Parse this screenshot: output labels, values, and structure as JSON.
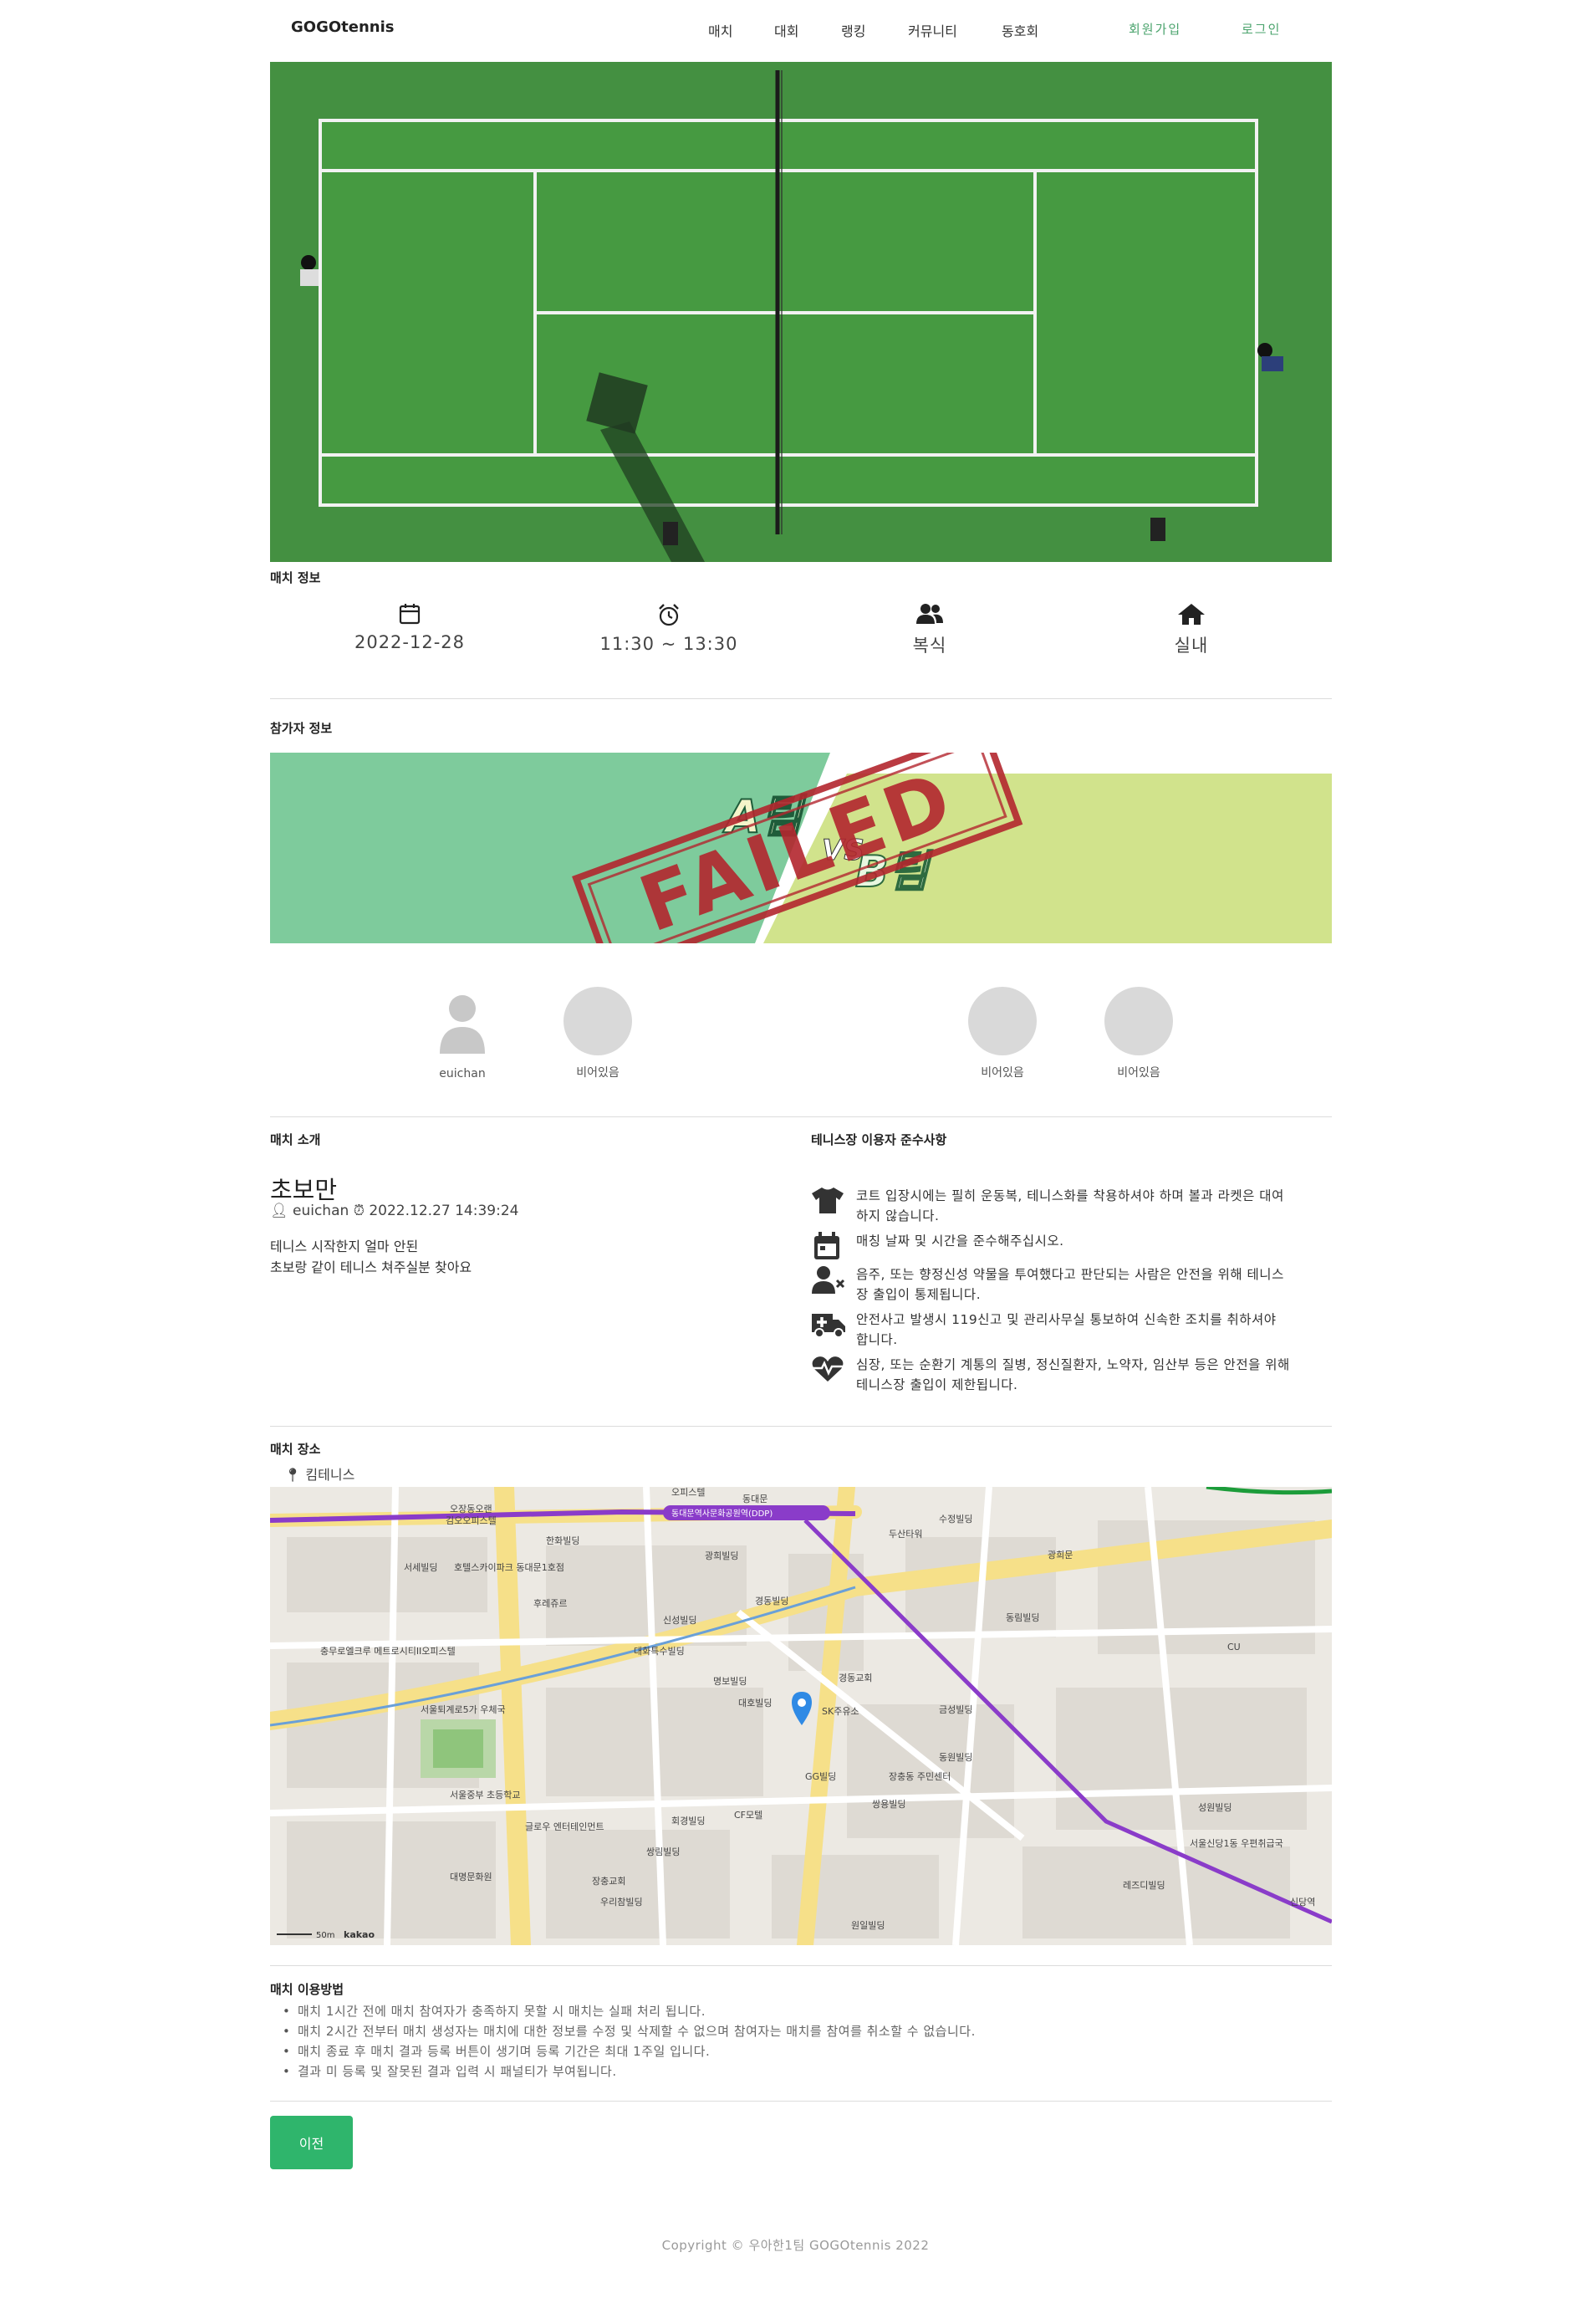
{
  "nav": {
    "brand": "GOGOtennis",
    "menu": [
      "매치",
      "대회",
      "랭킹",
      "커뮤니티",
      "동호회"
    ],
    "signup": "회원가입",
    "login": "로그인"
  },
  "match_info": {
    "title": "매치 정보",
    "date": "2022-12-28",
    "time": "11:30 ~ 13:30",
    "type": "복식",
    "venue_type": "실내"
  },
  "participants": {
    "title": "참가자 정보",
    "banner_team_a": "A팀",
    "banner_vs": "VS",
    "banner_team_b": "B팀",
    "stamp": "FAILED",
    "players": [
      {
        "name": "euichan"
      },
      {
        "name": "비어있음"
      },
      {
        "name": "비어있음"
      },
      {
        "name": "비어있음"
      }
    ]
  },
  "intro": {
    "title": "매치 소개",
    "heading": "초보만",
    "author": "euichan",
    "datetime": "2022.12.27 14:39:24",
    "line1": "테니스 시작한지 얼마 안된",
    "line2": "초보랑 같이 테니스 쳐주실분 찾아요"
  },
  "rules": {
    "title": "테니스장 이용자 준수사항",
    "items": [
      {
        "icon": "shirt-icon",
        "text": "코트 입장시에는 필히 운동복, 테니스화를 착용하셔야 하며 볼과 라켓은 대여하지 않습니다."
      },
      {
        "icon": "calendar-icon",
        "text": "매칭 날짜 및 시간을 준수해주십시오."
      },
      {
        "icon": "user-x-icon",
        "text": "음주, 또는 향정신성 약물을 투여했다고 판단되는 사람은 안전을 위해 테니스장 출입이 통제됩니다."
      },
      {
        "icon": "ambulance-icon",
        "text": "안전사고 발생시 119신고 및 관리사무실 통보하여 신속한 조치를 취하셔야 합니다."
      },
      {
        "icon": "heart-pulse-icon",
        "text": "심장, 또는 순환기 계통의 질병, 정신질환자, 노약자, 임산부 등은 안전을 위해 테니스장 출입이 제한됩니다."
      }
    ]
  },
  "place": {
    "title": "매치 장소",
    "name": "킴테니스",
    "map_scale": "50m",
    "map_brand": "kakao",
    "map_labels": [
      "오장동오랜",
      "김오오피스텔",
      "동대문",
      "한화빌딩",
      "서세빌딩",
      "호텔스카이파크 동대문1호점",
      "후레쥬르",
      "신성빌딩",
      "대화특수빌딩",
      "명보빌딩",
      "대호빌딩",
      "SK주유소",
      "경동교회",
      "금성빌딩",
      "쌍용빌딩",
      "충무로엘크루 메트로시티II오피스텔",
      "서울퇴계로5가 우체국",
      "서울중부 초등학교",
      "대명문화원",
      "글로우 엔터테인먼트",
      "회경빌딩",
      "CF모텔",
      "성원빌딩",
      "쌍림빌딩",
      "우리참빌딩",
      "장충교회",
      "원일빌딩",
      "GG빌딩",
      "장충동 주민센터",
      "동림빌딩",
      "동원빌딩",
      "광희빌딩",
      "레즈디빌딩",
      "수정빌딩",
      "오피스텔",
      "서울신당1동 우편취급국",
      "경동빌딩",
      "두산타워",
      "광희문",
      "신당역",
      "CU",
      "동대문역사문화공원역(DDP)"
    ]
  },
  "usage": {
    "title": "매치 이용방법",
    "items": [
      "매치 1시간 전에 매치 참여자가 충족하지 못할 시 매치는 실패 처리 됩니다.",
      "매치 2시간 전부터 매치 생성자는 매치에 대한 정보를 수정 및 삭제할 수 없으며 참여자는 매치를 참여를 취소할 수 없습니다.",
      "매치 종료 후 매치 결과 등록 버튼이 생기며 등록 기간은 최대 1주일 입니다.",
      "결과 미 등록 및 잘못된 결과 입력 시 패널티가 부여됩니다."
    ]
  },
  "buttons": {
    "prev": "이전"
  },
  "footer": {
    "copyright": "Copyright © 우아한1팀 GOGOtennis 2022"
  },
  "colors": {
    "accent": "#2fb56c",
    "team_a": "#7ecb9c",
    "team_b": "#d1e38c",
    "stamp": "#b3262e"
  }
}
